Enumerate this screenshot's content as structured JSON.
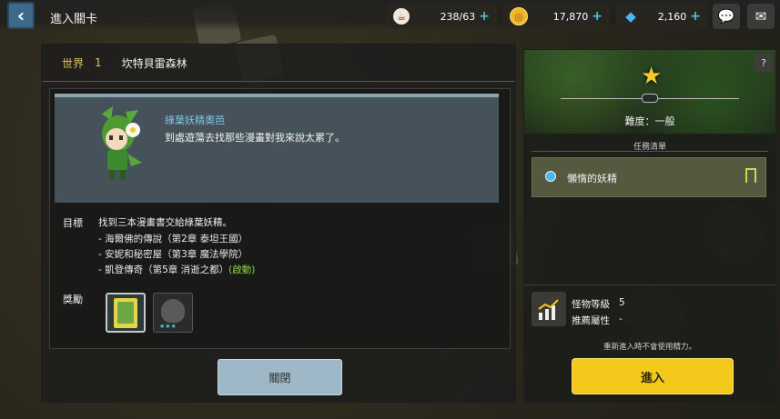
{
  "header": {
    "title": "進入關卡",
    "stamina": "238/63",
    "gold": "17,870",
    "gems": "2,160"
  },
  "world": {
    "label": "世界",
    "number": "1",
    "name": "坎特貝雷森林"
  },
  "quest": {
    "npc_name": "綠葉妖精奧芭",
    "npc_dialogue": "到處遊蕩去找那些漫畫對我來說太累了。",
    "goal_label": "目標",
    "goal_main": "找到三本漫畫書交給綠葉妖精。",
    "goal_items": [
      {
        "text": "- 海爾佛的傳說（第2章 泰坦王國）",
        "tag": ""
      },
      {
        "text": "- 安妮和秘密屋（第3章 魔法學院）",
        "tag": ""
      },
      {
        "text": "- 凱登傳奇（第5章 消逝之都）",
        "tag": "(啟動)"
      }
    ],
    "reward_label": "獎勵",
    "close_label": "關閉"
  },
  "stage": {
    "difficulty": "難度：一般",
    "task_list_title": "任務清單",
    "task": "懶惰的妖精",
    "monster_level_label": "怪物等級",
    "monster_level": "5",
    "attribute_label": "推薦屬性",
    "attribute": "-",
    "notice": "重新進入時不會使用精力。",
    "enter_label": "進入"
  },
  "icons": {
    "back": "back-arrow-icon",
    "stamina": "coffee-cup-icon",
    "gold": "gold-coin-icon",
    "gems": "diamond-icon",
    "chat": "chat-bubble-icon",
    "mail": "mail-icon",
    "help": "help-icon",
    "star": "star-icon",
    "bookmark": "bookmark-icon",
    "level": "chart-icon"
  },
  "colors": {
    "accent_yellow": "#f5c91c",
    "world_label": "#e0c060",
    "npc_name": "#7fc6ee",
    "active_tag": "#8ad84a",
    "plus": "#4bc3d8"
  }
}
